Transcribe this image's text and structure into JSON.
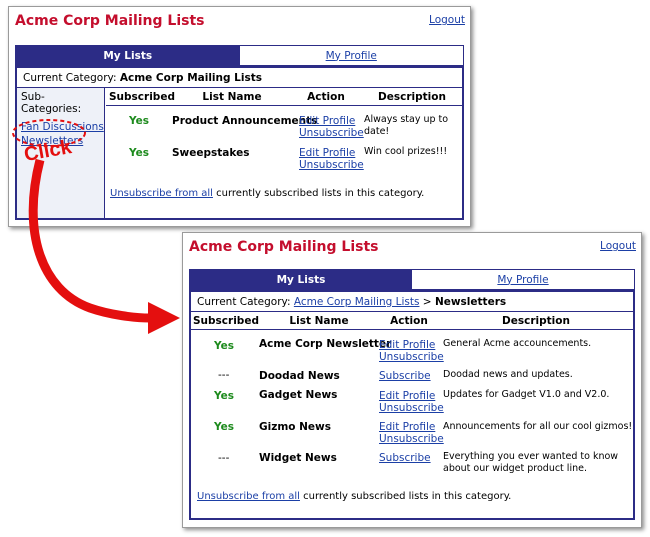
{
  "before": {
    "app_title": "Acme Corp Mailing Lists",
    "logout": "Logout",
    "tabs": [
      "My Lists",
      "My Profile"
    ],
    "category_label": "Current Category:",
    "category_name": "Acme Corp Mailing Lists",
    "subcategories_label": "Sub-Categories:",
    "subcategories": [
      "Fan Discussions",
      "Newsletters"
    ],
    "columns": [
      "Subscribed",
      "List Name",
      "Action",
      "Description"
    ],
    "rows": [
      {
        "subscribed": "Yes",
        "name": "Product Announcements",
        "actions": [
          "Edit Profile",
          "Unsubscribe"
        ],
        "description": "Always stay up to date!"
      },
      {
        "subscribed": "Yes",
        "name": "Sweepstakes",
        "actions": [
          "Edit Profile",
          "Unsubscribe"
        ],
        "description": "Win cool prizes!!!"
      }
    ],
    "footer_link": "Unsubscribe from all",
    "footer_text": " currently subscribed lists in this category."
  },
  "annotation": {
    "click_label": "Click"
  },
  "after": {
    "app_title": "Acme Corp Mailing Lists",
    "logout": "Logout",
    "tabs": [
      "My Lists",
      "My Profile"
    ],
    "category_label": "Current Category:",
    "category_link": "Acme Corp Mailing Lists",
    "category_sep": " > ",
    "category_current": "Newsletters",
    "columns": [
      "Subscribed",
      "List Name",
      "Action",
      "Description"
    ],
    "rows": [
      {
        "subscribed": "Yes",
        "name": "Acme Corp Newsletter",
        "actions": [
          "Edit Profile",
          "Unsubscribe"
        ],
        "description": "General Acme accouncements."
      },
      {
        "subscribed": "---",
        "name": "Doodad News",
        "actions": [
          "Subscribe"
        ],
        "description": "Doodad news and updates."
      },
      {
        "subscribed": "Yes",
        "name": "Gadget News",
        "actions": [
          "Edit Profile",
          "Unsubscribe"
        ],
        "description": "Updates for Gadget V1.0 and V2.0."
      },
      {
        "subscribed": "Yes",
        "name": "Gizmo News",
        "actions": [
          "Edit Profile",
          "Unsubscribe"
        ],
        "description": "Announcements for all our cool gizmos!"
      },
      {
        "subscribed": "---",
        "name": "Widget News",
        "actions": [
          "Subscribe"
        ],
        "description": "Everything you ever wanted to know about our widget product line."
      }
    ],
    "footer_link": "Unsubscribe from all",
    "footer_text": " currently subscribed lists in this category."
  },
  "colors": {
    "title_red": "#c40e2d",
    "tab_navy": "#2c2c86",
    "link_blue": "#1b3fa6",
    "yes_green": "#1c8a1c",
    "annotation_red": "#e40f0f"
  }
}
